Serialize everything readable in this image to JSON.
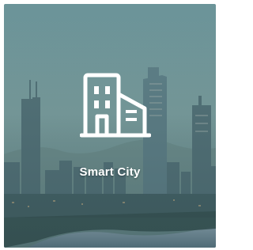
{
  "card": {
    "title": "Smart City",
    "icon": "city-buildings-icon"
  }
}
